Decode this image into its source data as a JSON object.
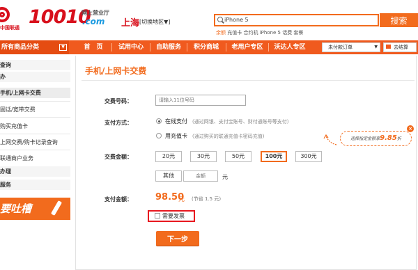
{
  "brand": {
    "name_cn": "中国联通",
    "number": "10010",
    "sub": "网上营业厅",
    "domain": ".com"
  },
  "location": {
    "city": "上海",
    "switch_label": "[切换地区▼]"
  },
  "search": {
    "value": "iPhone 5",
    "button": "搜索",
    "hot_first": "余额",
    "hot_rest": "  充值卡  合约机  iPhone 5 话费  套餐"
  },
  "nav": {
    "all_categories": "所有商品分类",
    "items": [
      "首　页",
      "试用中心",
      "自助服务",
      "积分商城",
      "老用户专区",
      "沃达人专区"
    ],
    "unpaid_orders": "未付款订单",
    "checkout": "去结算"
  },
  "sidebar": {
    "items": [
      {
        "label": "查询",
        "type": "head"
      },
      {
        "label": "办",
        "type": "head"
      },
      {
        "label": "手机/上网卡交费",
        "type": "sub-head"
      },
      {
        "label": "固话/宽带交费",
        "type": "item"
      },
      {
        "label": "购买充值卡",
        "type": "item"
      },
      {
        "label": "上网交费/购卡记录查询",
        "type": "item"
      },
      {
        "label": "联通商户业务",
        "type": "item"
      },
      {
        "label": "办理",
        "type": "head"
      },
      {
        "label": "服务",
        "type": "head"
      }
    ],
    "banner": "要吐槽"
  },
  "main": {
    "title": "手机/上网卡交费",
    "phone_label": "交费号码：",
    "phone_placeholder": "请输入11位号码",
    "paymethod_label": "支付方式：",
    "pay_methods": [
      {
        "name": "在线支付",
        "desc": "(通过网银、支付宝账号、财付通账号等支付)",
        "selected": true
      },
      {
        "name": "用充值卡",
        "desc": "(通过购买的联通充值卡密码充值)",
        "selected": false
      }
    ],
    "amount_label": "交费金额：",
    "amounts": [
      {
        "label": "20元",
        "selected": false
      },
      {
        "label": "30元",
        "selected": false
      },
      {
        "label": "50元",
        "selected": false
      },
      {
        "label": "100元",
        "selected": true
      },
      {
        "label": "300元",
        "selected": false
      }
    ],
    "other_label": "其他",
    "custom_placeholder": "金额",
    "unit": "元",
    "total_label": "支付金额：",
    "total_value": "98.50",
    "total_unit": "元",
    "saving": "(节省 1.5 元)",
    "invoice_label": "需要发票",
    "invoice_checked": false,
    "next_button": "下一步",
    "tip_prefix": "选择指定金额享",
    "tip_value": "9.85",
    "tip_suffix": "折",
    "tip_close": "×"
  },
  "colors": {
    "brand_red": "#d8101c",
    "accent_orange": "#f26b1d",
    "invoice_highlight": "#e8171f"
  }
}
